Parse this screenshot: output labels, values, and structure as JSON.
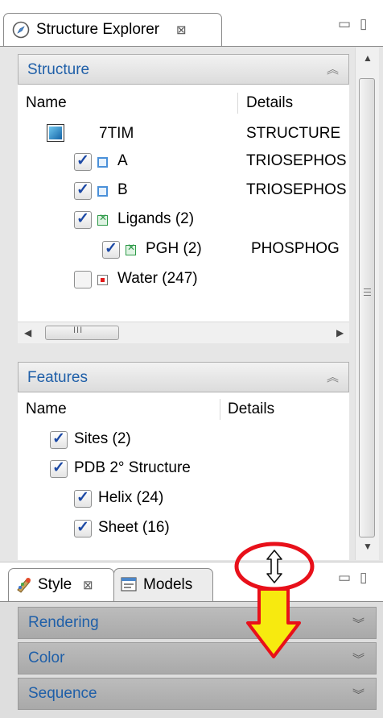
{
  "explorer_tab": {
    "title": "Structure Explorer",
    "close_glyph": "⊠"
  },
  "window_controls": {
    "minimize": "▭",
    "maximize": "▯"
  },
  "structure": {
    "title": "Structure",
    "col_name": "Name",
    "col_details": "Details",
    "rows": [
      {
        "name": "7TIM",
        "details": "STRUCTURE"
      },
      {
        "name": "A",
        "details": "TRIOSEPHOS"
      },
      {
        "name": "B",
        "details": "TRIOSEPHOS"
      },
      {
        "name": "Ligands (2)",
        "details": ""
      },
      {
        "name": "PGH (2)",
        "details": "PHOSPHOG"
      },
      {
        "name": "Water (247)",
        "details": ""
      }
    ],
    "hscroll_grip": "III"
  },
  "features": {
    "title": "Features",
    "col_name": "Name",
    "col_details": "Details",
    "rows": [
      {
        "name": "Sites (2)"
      },
      {
        "name": "PDB 2° Structure"
      },
      {
        "name": "Helix (24)"
      },
      {
        "name": "Sheet (16)"
      }
    ]
  },
  "bottom_tabs": {
    "style_label": "Style",
    "style_close": "⊠",
    "models_label": "Models"
  },
  "style_sections": [
    {
      "title": "Rendering"
    },
    {
      "title": "Color"
    },
    {
      "title": "Sequence"
    }
  ],
  "colors": {
    "section_title": "#1f5fa8",
    "annotation_circle": "#e8101a",
    "annotation_arrow_fill": "#f7ea0f"
  }
}
